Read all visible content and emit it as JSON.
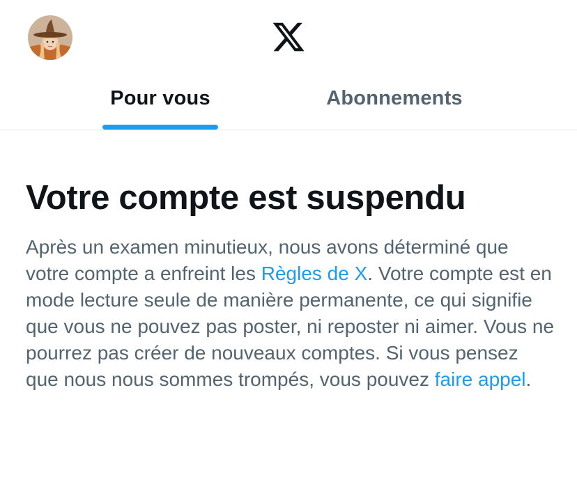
{
  "header": {
    "avatar_icon": "user-avatar",
    "logo_icon": "x-logo-icon"
  },
  "tabs": [
    {
      "label": "Pour vous",
      "active": true
    },
    {
      "label": "Abonnements",
      "active": false
    }
  ],
  "notice": {
    "title": "Votre compte est suspendu",
    "body_part1": "Après un examen minutieux, nous avons déterminé que votre compte a enfreint les ",
    "rules_link": "Règles de X",
    "body_part2": ". Votre compte est en mode lecture seule de manière permanente, ce qui signifie que vous ne pouvez pas poster, ni reposter ni aimer. Vous ne pourrez pas créer de nouveaux comptes. Si vous pensez que nous nous sommes trompés, vous pouvez ",
    "appeal_link": "faire appel",
    "body_part3": "."
  },
  "colors": {
    "accent": "#1d9bf0",
    "text_primary": "#0f1419",
    "text_secondary": "#536471",
    "divider": "#dfe3e6"
  }
}
